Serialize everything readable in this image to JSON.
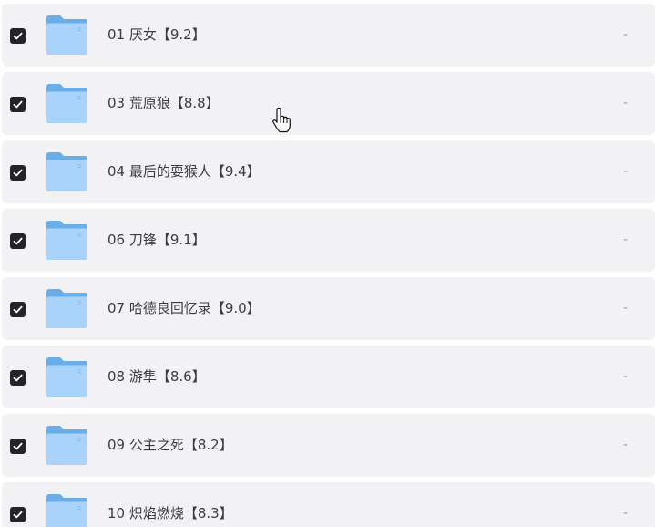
{
  "files": [
    {
      "name": "01 厌女【9.2】",
      "size": "-",
      "checked": true
    },
    {
      "name": "03 荒原狼【8.8】",
      "size": "-",
      "checked": true
    },
    {
      "name": "04 最后的耍猴人【9.4】",
      "size": "-",
      "checked": true
    },
    {
      "name": "06 刀锋【9.1】",
      "size": "-",
      "checked": true
    },
    {
      "name": "07 哈德良回忆录【9.0】",
      "size": "-",
      "checked": true
    },
    {
      "name": "08 游隼【8.6】",
      "size": "-",
      "checked": true
    },
    {
      "name": "09 公主之死【8.2】",
      "size": "-",
      "checked": true
    },
    {
      "name": "10 炽焰燃烧【8.3】",
      "size": "-",
      "checked": true
    }
  ],
  "icons": {
    "checkbox": "checkmark-icon",
    "folder": "folder-icon",
    "cursor": "hand-pointer-icon"
  },
  "colors": {
    "row_background": "#f2f2f5",
    "checkbox_fill": "#23242a",
    "folder_back": "#6aaee9",
    "folder_front": "#a9d3fb"
  }
}
